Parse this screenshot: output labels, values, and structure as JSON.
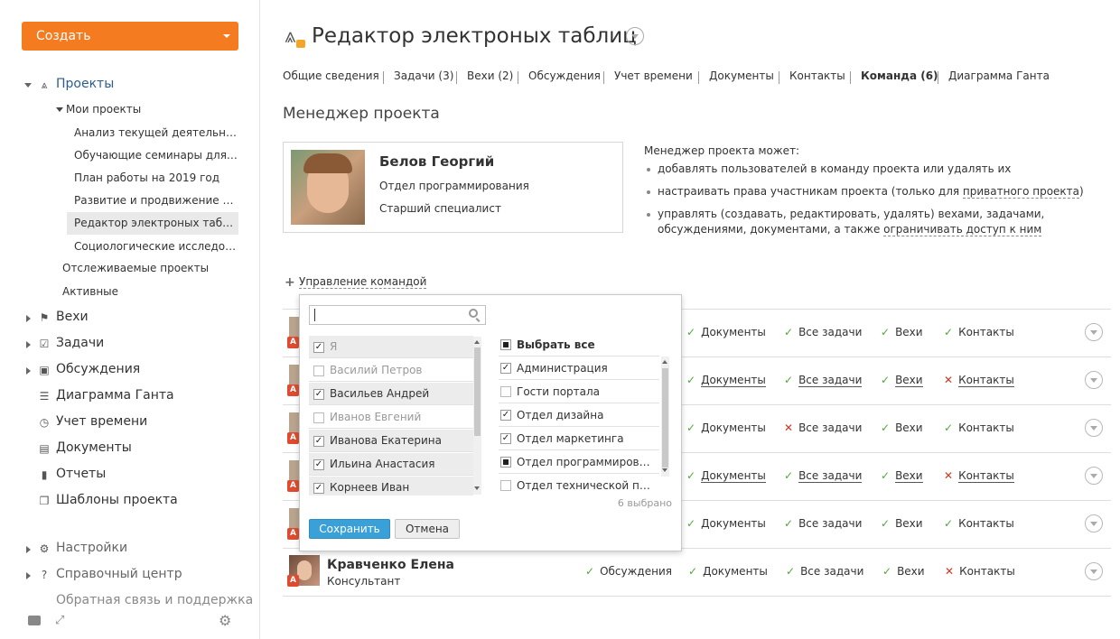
{
  "sidebar": {
    "create_label": "Создать",
    "nav": [
      {
        "label": "Проекты",
        "icon": "projects-icon"
      },
      {
        "label": "Вехи",
        "icon": "flag-icon"
      },
      {
        "label": "Задачи",
        "icon": "tasks-icon"
      },
      {
        "label": "Обсуждения",
        "icon": "discussion-icon"
      },
      {
        "label": "Диаграмма Ганта",
        "icon": "gantt-icon"
      },
      {
        "label": "Учет времени",
        "icon": "clock-icon"
      },
      {
        "label": "Документы",
        "icon": "documents-icon"
      },
      {
        "label": "Отчеты",
        "icon": "reports-icon"
      },
      {
        "label": "Шаблоны проекта",
        "icon": "templates-icon"
      },
      {
        "label": "Настройки",
        "icon": "gear-icon"
      },
      {
        "label": "Справочный центр",
        "icon": "help-icon"
      },
      {
        "label": "Обратная связь и поддержка",
        "icon": "megaphone-icon"
      }
    ],
    "my_projects_label": "Мои проекты",
    "projects": [
      "Анализ текущей деятельности",
      "Обучающие семинары для сотрудников",
      "План работы на 2019 год",
      "Развитие и продвижение продукта",
      "Редактор электроных таблиц",
      "Социологические исследования"
    ],
    "tracked_label": "Отслеживаемые проекты",
    "active_label": "Активные"
  },
  "header": {
    "title": "Редактор электроных таблиц"
  },
  "tabs": [
    "Общие сведения",
    "Задачи (3)",
    "Вехи (2)",
    "Обсуждения",
    "Учет времени",
    "Документы",
    "Контакты",
    "Команда (6)",
    "Диаграмма Ганта"
  ],
  "manager": {
    "section_title": "Менеджер проекта",
    "name": "Белов Георгий",
    "department": "Отдел программирования",
    "position": "Старший специалист",
    "rights_title": "Менеджер проекта может:",
    "rights": [
      "добавлять пользователей в команду проекта или удалять их",
      "настраивать права участникам проекта (только для ",
      "управлять (создавать, редактировать, удалять) вехами, задачами, обсуждениями, документами, а также "
    ],
    "rights_link1": "приватного проекта",
    "rights_link1_tail": ")",
    "rights_link2": "ограничивать доступ к ним"
  },
  "team_manage_label": "Управление командой",
  "team_rows": [
    {
      "perms": [
        [
          "ok",
          "Документы"
        ],
        [
          "ok",
          "Все задачи"
        ],
        [
          "ok",
          "Вехи"
        ],
        [
          "ok",
          "Контакты"
        ]
      ],
      "ul": false
    },
    {
      "perms": [
        [
          "ok",
          "Документы"
        ],
        [
          "ok",
          "Все задачи"
        ],
        [
          "ok",
          "Вехи"
        ],
        [
          "no",
          "Контакты"
        ]
      ],
      "ul": true
    },
    {
      "perms": [
        [
          "ok",
          "Документы"
        ],
        [
          "no",
          "Все задачи"
        ],
        [
          "ok",
          "Вехи"
        ],
        [
          "ok",
          "Контакты"
        ]
      ],
      "ul": false
    },
    {
      "perms": [
        [
          "ok",
          "Документы"
        ],
        [
          "ok",
          "Все задачи"
        ],
        [
          "ok",
          "Вехи"
        ],
        [
          "no",
          "Контакты"
        ]
      ],
      "ul": true
    },
    {
      "perms": [
        [
          "ok",
          "Документы"
        ],
        [
          "ok",
          "Все задачи"
        ],
        [
          "ok",
          "Вехи"
        ],
        [
          "ok",
          "Контакты"
        ]
      ],
      "ul": false
    }
  ],
  "last_member": {
    "name": "Кравченко Елена",
    "position": "Консультант",
    "perms": [
      [
        "ok",
        "Обсуждения"
      ],
      [
        "ok",
        "Документы"
      ],
      [
        "ok",
        "Все задачи"
      ],
      [
        "ok",
        "Вехи"
      ],
      [
        "no",
        "Контакты"
      ]
    ]
  },
  "popup": {
    "search_placeholder": "",
    "users": [
      {
        "name": "Я",
        "checked": true,
        "shaded": true,
        "muted": true
      },
      {
        "name": "Василий Петров",
        "checked": false,
        "shaded": false,
        "muted": true
      },
      {
        "name": "Васильев Андрей",
        "checked": true,
        "shaded": true,
        "muted": false
      },
      {
        "name": "Иванов Евгений",
        "checked": false,
        "shaded": false,
        "muted": true
      },
      {
        "name": "Иванова Екатерина",
        "checked": true,
        "shaded": true,
        "muted": false
      },
      {
        "name": "Ильина Анастасия",
        "checked": true,
        "shaded": true,
        "muted": false
      },
      {
        "name": "Корнеев Иван",
        "checked": true,
        "shaded": true,
        "muted": false
      }
    ],
    "select_all_label": "Выбрать все",
    "groups": [
      {
        "name": "Администрация",
        "state": "checked"
      },
      {
        "name": "Гости портала",
        "state": "unchecked"
      },
      {
        "name": "Отдел дизайна",
        "state": "checked"
      },
      {
        "name": "Отдел маркетинга",
        "state": "checked"
      },
      {
        "name": "Отдел программирования",
        "state": "partial"
      },
      {
        "name": "Отдел технической поддержки",
        "state": "unchecked"
      }
    ],
    "selected_count": "6 выбрано",
    "save_label": "Сохранить",
    "cancel_label": "Отмена"
  }
}
